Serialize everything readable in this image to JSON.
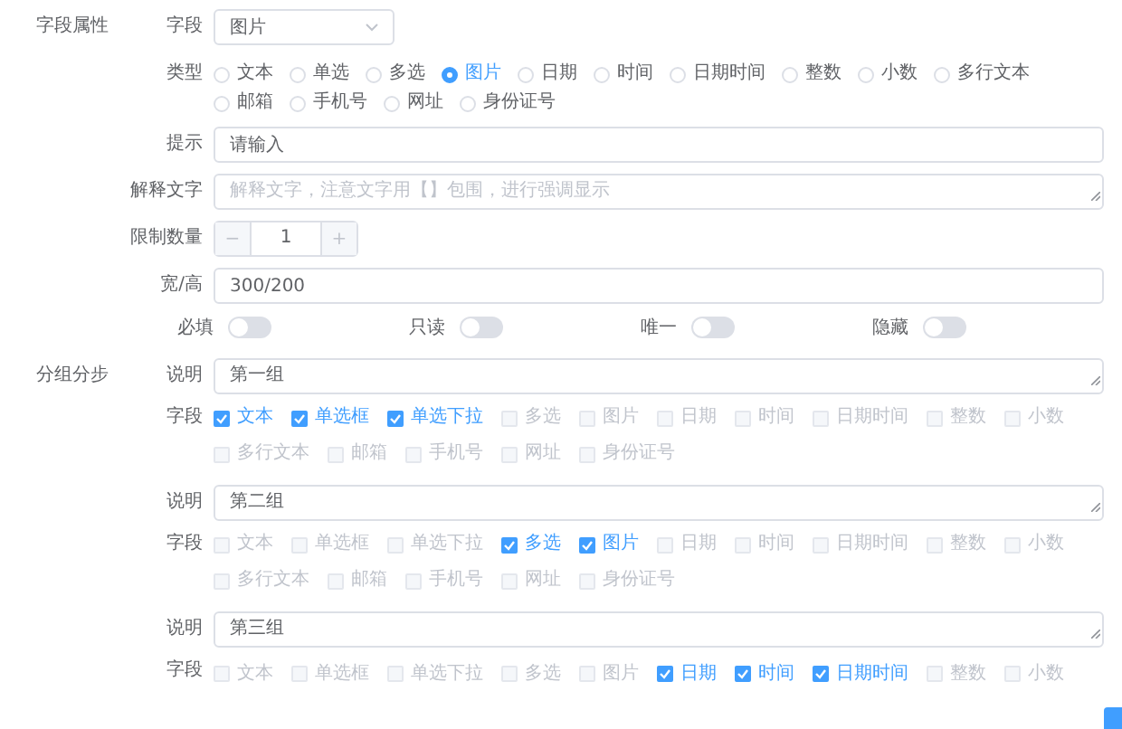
{
  "section_title": "字段属性",
  "field": {
    "label": "字段",
    "value": "图片"
  },
  "type": {
    "label": "类型",
    "options": [
      {
        "label": "文本",
        "selected": false
      },
      {
        "label": "单选",
        "selected": false
      },
      {
        "label": "多选",
        "selected": false
      },
      {
        "label": "图片",
        "selected": true
      },
      {
        "label": "日期",
        "selected": false
      },
      {
        "label": "时间",
        "selected": false
      },
      {
        "label": "日期时间",
        "selected": false
      },
      {
        "label": "整数",
        "selected": false
      },
      {
        "label": "小数",
        "selected": false
      },
      {
        "label": "多行文本",
        "selected": false
      },
      {
        "label": "邮箱",
        "selected": false
      },
      {
        "label": "手机号",
        "selected": false
      },
      {
        "label": "网址",
        "selected": false
      },
      {
        "label": "身份证号",
        "selected": false
      }
    ]
  },
  "hint": {
    "label": "提示",
    "value": "请输入"
  },
  "explanation": {
    "label": "解释文字",
    "placeholder": "解释文字，注意文字用【】包围，进行强调显示"
  },
  "limit": {
    "label": "限制数量",
    "minus": "−",
    "value": "1",
    "plus": "+"
  },
  "size": {
    "label": "宽/高",
    "value": "300/200"
  },
  "switches": [
    {
      "label": "必填",
      "on": false
    },
    {
      "label": "只读",
      "on": false
    },
    {
      "label": "唯一",
      "on": false
    },
    {
      "label": "隐藏",
      "on": false
    }
  ],
  "groups_title": "分组分步",
  "groups": [
    {
      "desc_label": "说明",
      "desc": "第一组",
      "fields_label": "字段",
      "fields": [
        {
          "label": "文本",
          "checked": true
        },
        {
          "label": "单选框",
          "checked": true
        },
        {
          "label": "单选下拉",
          "checked": true
        },
        {
          "label": "多选",
          "checked": false
        },
        {
          "label": "图片",
          "checked": false
        },
        {
          "label": "日期",
          "checked": false
        },
        {
          "label": "时间",
          "checked": false
        },
        {
          "label": "日期时间",
          "checked": false
        },
        {
          "label": "整数",
          "checked": false
        },
        {
          "label": "小数",
          "checked": false
        },
        {
          "label": "多行文本",
          "checked": false
        },
        {
          "label": "邮箱",
          "checked": false
        },
        {
          "label": "手机号",
          "checked": false
        },
        {
          "label": "网址",
          "checked": false
        },
        {
          "label": "身份证号",
          "checked": false
        }
      ]
    },
    {
      "desc_label": "说明",
      "desc": "第二组",
      "fields_label": "字段",
      "fields": [
        {
          "label": "文本",
          "checked": false
        },
        {
          "label": "单选框",
          "checked": false
        },
        {
          "label": "单选下拉",
          "checked": false
        },
        {
          "label": "多选",
          "checked": true
        },
        {
          "label": "图片",
          "checked": true
        },
        {
          "label": "日期",
          "checked": false
        },
        {
          "label": "时间",
          "checked": false
        },
        {
          "label": "日期时间",
          "checked": false
        },
        {
          "label": "整数",
          "checked": false
        },
        {
          "label": "小数",
          "checked": false
        },
        {
          "label": "多行文本",
          "checked": false
        },
        {
          "label": "邮箱",
          "checked": false
        },
        {
          "label": "手机号",
          "checked": false
        },
        {
          "label": "网址",
          "checked": false
        },
        {
          "label": "身份证号",
          "checked": false
        }
      ]
    },
    {
      "desc_label": "说明",
      "desc": "第三组",
      "fields_label": "字段",
      "fields": [
        {
          "label": "文本",
          "checked": false
        },
        {
          "label": "单选框",
          "checked": false
        },
        {
          "label": "单选下拉",
          "checked": false
        },
        {
          "label": "多选",
          "checked": false
        },
        {
          "label": "图片",
          "checked": false
        },
        {
          "label": "日期",
          "checked": true
        },
        {
          "label": "时间",
          "checked": true
        },
        {
          "label": "日期时间",
          "checked": true
        },
        {
          "label": "整数",
          "checked": false
        },
        {
          "label": "小数",
          "checked": false
        }
      ]
    }
  ]
}
